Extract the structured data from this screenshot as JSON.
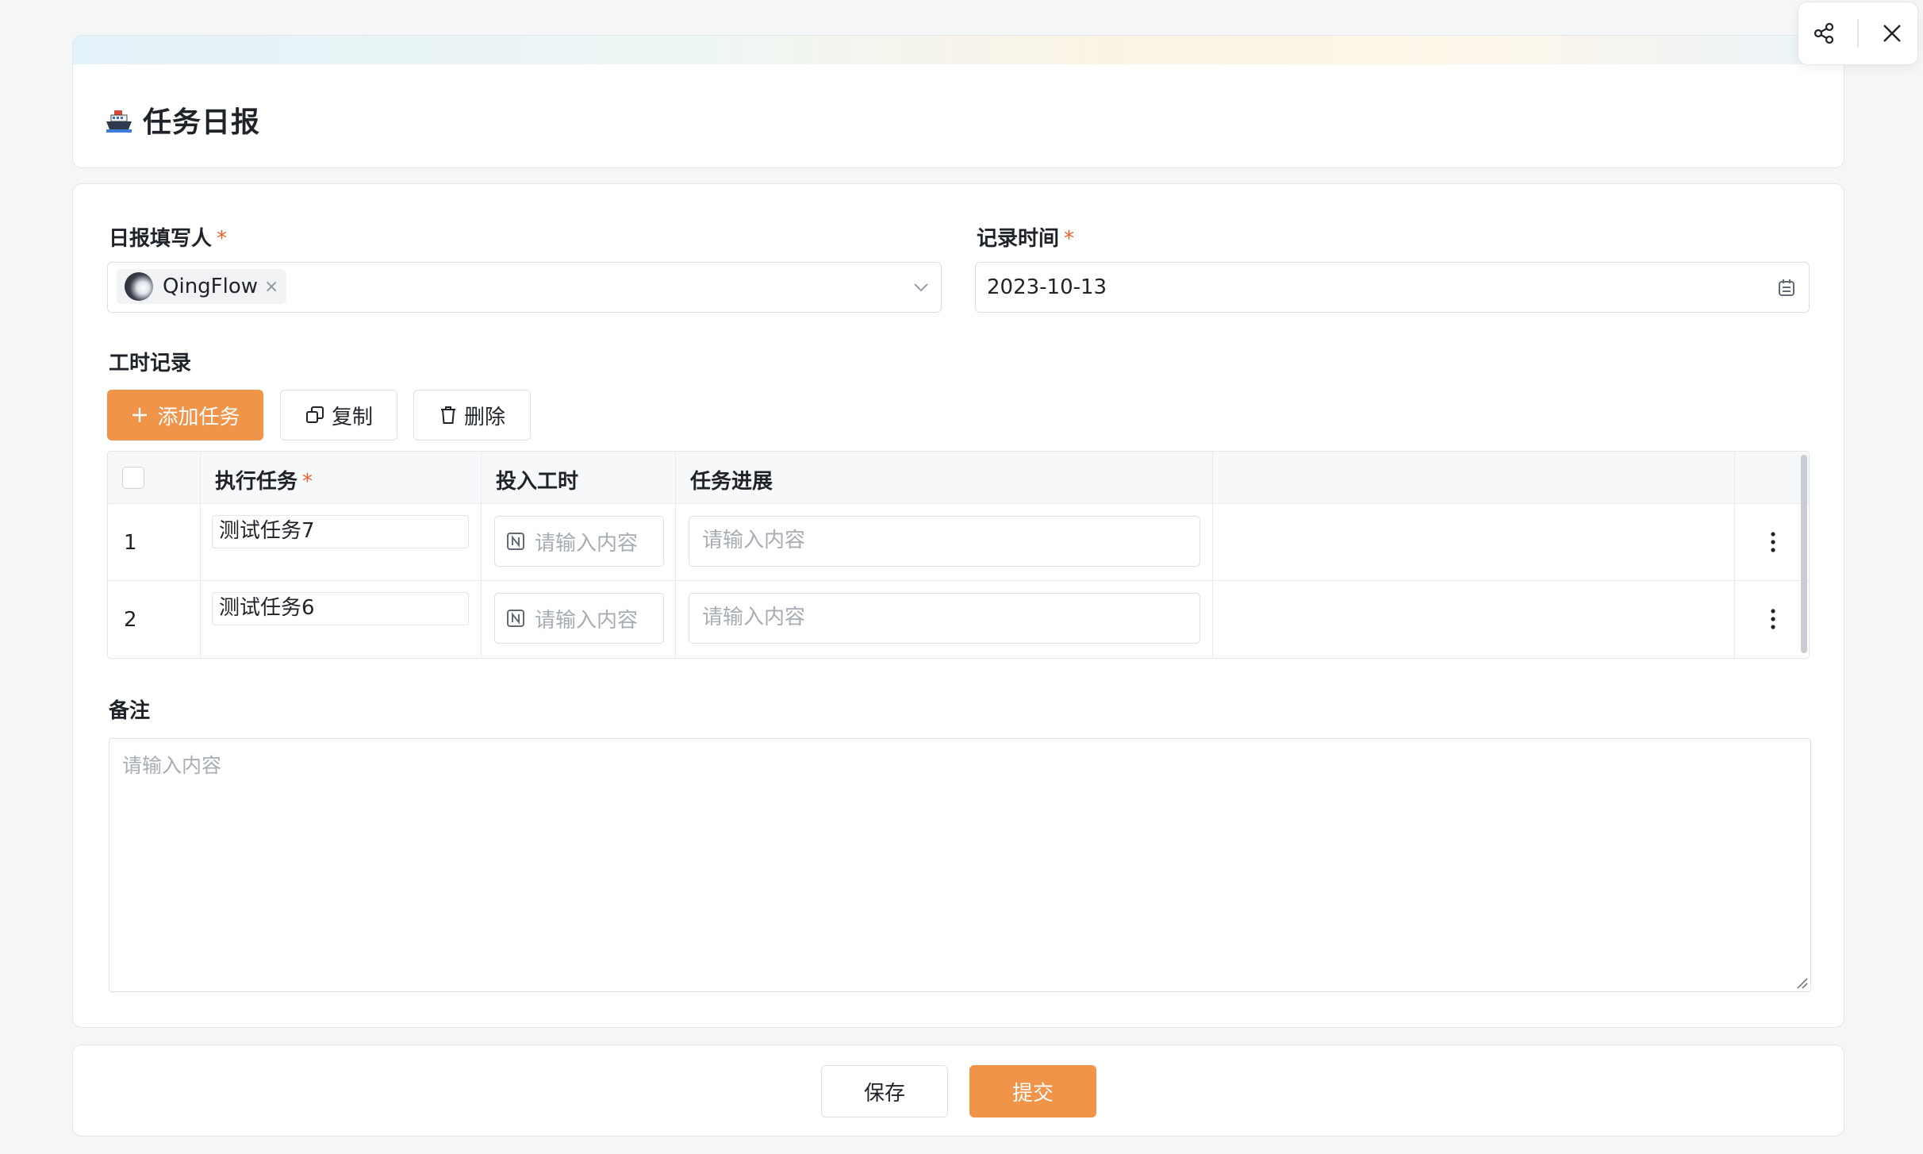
{
  "header": {
    "title": "任务日报",
    "icon": "ship-icon"
  },
  "top_actions": {
    "share_icon": "share-icon",
    "close_icon": "close-icon"
  },
  "form": {
    "reporter": {
      "label": "日报填写人",
      "required_mark": "*",
      "user_name": "QingFlow",
      "remove_glyph": "×"
    },
    "record_time": {
      "label": "记录时间",
      "required_mark": "*",
      "value": "2023-10-13"
    },
    "worklog": {
      "label": "工时记录",
      "toolbar": {
        "add_label": "添加任务",
        "copy_label": "复制",
        "delete_label": "删除"
      },
      "table": {
        "columns": [
          "执行任务",
          "投入工时",
          "任务进展"
        ],
        "task_required_mark": "*",
        "rows": [
          {
            "index": "1",
            "task": "测试任务7",
            "hours_placeholder": "请输入内容",
            "progress_placeholder": "请输入内容"
          },
          {
            "index": "2",
            "task": "测试任务6",
            "hours_placeholder": "请输入内容",
            "progress_placeholder": "请输入内容"
          }
        ]
      }
    },
    "remarks": {
      "label": "备注",
      "placeholder": "请输入内容"
    }
  },
  "footer": {
    "save_label": "保存",
    "submit_label": "提交"
  },
  "colors": {
    "accent": "#f0944a",
    "required": "#e8612c",
    "border": "#dcdfe5",
    "background": "#f5f6f8"
  }
}
